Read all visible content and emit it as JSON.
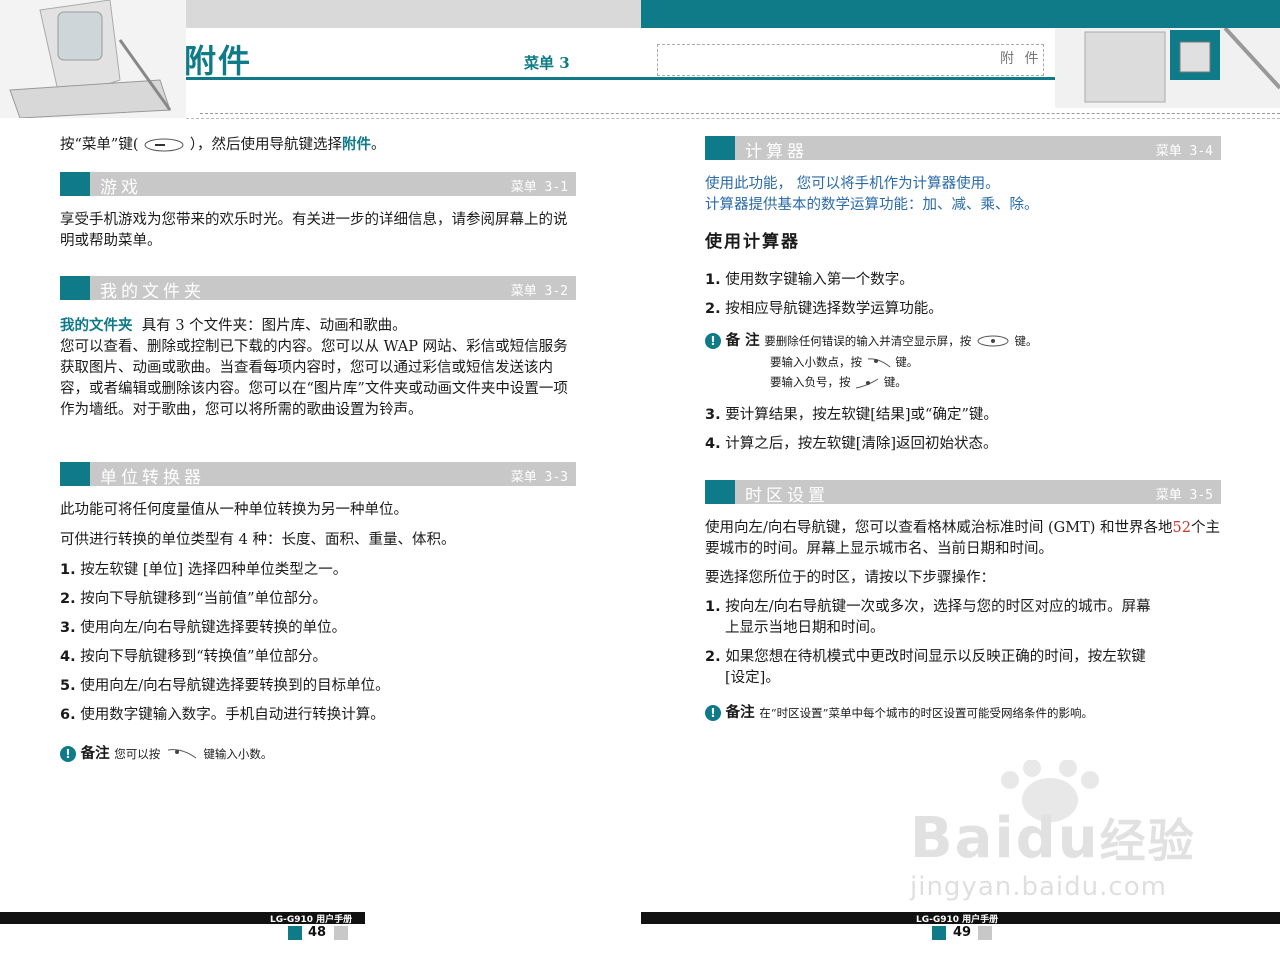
{
  "header": {
    "title": "附件",
    "menu": "菜单 3",
    "right_label": "附 件"
  },
  "left": {
    "intro": [
      "按“菜单”键(",
      "），然后使用导航键选择",
      "附件",
      "。"
    ],
    "s1": {
      "title": "游戏",
      "menu": "菜单 3-1",
      "body": "享受手机游戏为您带来的欢乐时光。有关进一步的详细信息，请参阅屏幕上的说明或帮助菜单。"
    },
    "s2": {
      "title": "我的文件夹",
      "menu": "菜单 3-2",
      "lead": "我的文件夹",
      "body1": "具有 3 个文件夹：图片库、动画和歌曲。",
      "body2": "您可以查看、删除或控制已下载的内容。您可以从 WAP 网站、彩信或短信服务 获取图片、动画或歌曲。当查看每项内容时，您可以通过彩信或短信发送该内容，或者编辑或删除该内容。您可以在“图片库”文件夹或动画文件夹中设置一项作为墙纸。对于歌曲，您可以将所需的歌曲设置为铃声。"
    },
    "s3": {
      "title": "单位转换器",
      "menu": "菜单 3-3",
      "p1": "此功能可将任何度量值从一种单位转换为另一种单位。",
      "p2": "可供进行转换的单位类型有 4 种：长度、面积、重量、体积。",
      "steps": [
        {
          "n": "1.",
          "t": "按左软键 [单位] 选择四种单位类型之一。"
        },
        {
          "n": "2.",
          "t": "按向下导航键移到“当前值”单位部分。"
        },
        {
          "n": "3.",
          "t": "使用向左/向右导航键选择要转换的单位。"
        },
        {
          "n": "4.",
          "t": "按向下导航键移到“转换值”单位部分。"
        },
        {
          "n": "5.",
          "t": "使用向左/向右导航键选择要转换到的目标单位。"
        },
        {
          "n": "6.",
          "t": "使用数字键输入数字。手机自动进行转换计算。"
        }
      ],
      "note_label": "备注",
      "note_a": "您可以按",
      "note_b": "键输入小数。"
    }
  },
  "right": {
    "s4": {
      "title": "计算器",
      "menu": "菜单 3-4",
      "intro1": "使用此功能， 您可以将手机作为计算器使用。",
      "intro2": "计算器提供基本的数学运算功能：加、减、乘、除。",
      "subhead": "使用计算器",
      "steps": [
        {
          "n": "1.",
          "t": "使用数字键输入第一个数字。"
        },
        {
          "n": "2.",
          "t": "按相应导航键选择数学运算功能。"
        }
      ],
      "note_label": "备 注",
      "note1a": "要删除任何错误的输入并清空显示屏，按",
      "note1b": "键。",
      "note2a": "要输入小数点，按",
      "note2b": "键。",
      "note3a": "要输入负号，按",
      "note3b": "键。",
      "steps2": [
        {
          "n": "3.",
          "t": "要计算结果，按左软键[结果]或“确定”键。"
        },
        {
          "n": "4.",
          "t": "计算之后，按左软键[清除]返回初始状态。"
        }
      ]
    },
    "s5": {
      "title": "时区设置",
      "menu": "菜单 3-5",
      "p1a": "使用向左/向右导航键，您可以查看格林威治标准时间 (GMT) 和世界各地",
      "p1num": "52",
      "p1b": "个主要城市的时间。屏幕上显示城市名、当前日期和时间。",
      "p2": "要选择您所位于的时区，请按以下步骤操作：",
      "steps": [
        {
          "n": "1.",
          "t1": "按向左/向右导航键一次或多次，选择与您的时区对应的城市。屏幕",
          "t2": "上显示当地日期和时间。"
        },
        {
          "n": "2.",
          "t1": "如果您想在待机模式中更改时间显示以反映正确的时间，按左软键",
          "t2": "[设定]。"
        }
      ],
      "note_label": "备注",
      "note": "在“时区设置”菜单中每个城市的时区设置可能受网络条件的影响。"
    }
  },
  "footer": {
    "left_label": "LG-G910 用户手册",
    "left_page": "48",
    "right_label": "LG-G910 用户手册",
    "right_page": "49"
  },
  "watermark": {
    "brand": "Bai",
    "brand2": "du",
    "cn": "经验",
    "url": "jingyan.baidu.com"
  },
  "colors": {
    "accent": "#0f7b88",
    "bar": "#c8c8c8",
    "link": "#2a6aa8"
  }
}
